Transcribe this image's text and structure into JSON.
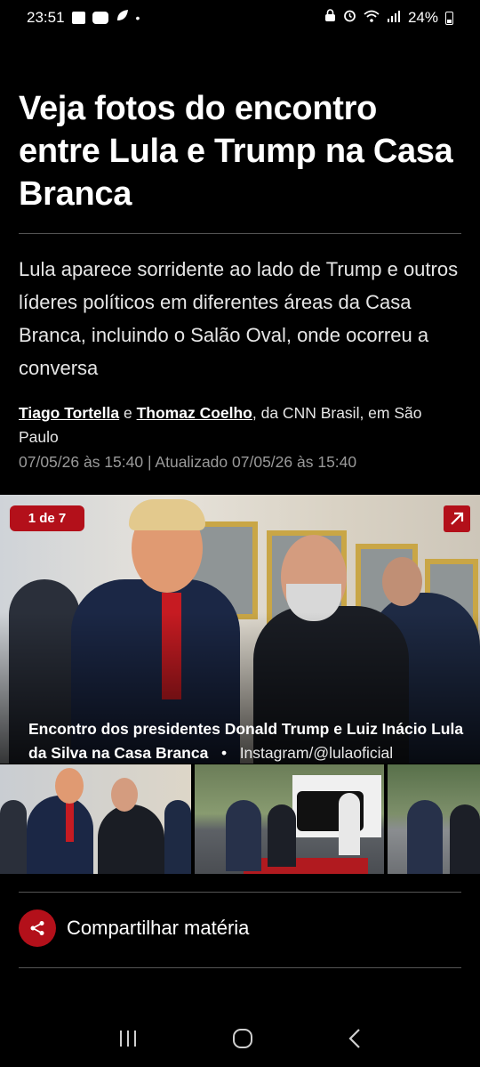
{
  "status_bar": {
    "time": "23:51",
    "left_icons": [
      "gallery-icon",
      "youtube-icon",
      "leaf-icon"
    ],
    "dot": "•",
    "right_icons": [
      "lock-icon",
      "alarm-icon",
      "wifi-icon",
      "signal-icon",
      "battery-icon"
    ],
    "battery_percent": "24%"
  },
  "article": {
    "headline": "Veja fotos do encontro entre Lula e Trump na Casa Branca",
    "subtitle": "Lula aparece sorridente ao lado de Trump e outros líderes políticos em diferentes áreas da Casa Branca, incluindo o Salão Oval, onde ocorreu a conversa",
    "byline": {
      "author1": "Tiago Tortella",
      "conjunction": " e ",
      "author2": "Thomaz Coelho",
      "suffix": ", da CNN Brasil, em São Paulo"
    },
    "dates": "07/05/26 às 15:40 | Atualizado 07/05/26 às 15:40"
  },
  "gallery": {
    "counter": "1 de 7",
    "caption": "Encontro dos presidentes Donald Trump e Luiz Inácio Lula da Silva na Casa Branca",
    "separator": "•",
    "credit": "Instagram/@lulaoficial",
    "thumbnail_count": 3
  },
  "share": {
    "label": "Compartilhar matéria"
  },
  "colors": {
    "accent": "#b3101a",
    "background": "#000000",
    "divider": "#555555",
    "muted_text": "#9a9a9a"
  },
  "navbar": {
    "icons": [
      "recent-apps-icon",
      "home-icon",
      "back-icon"
    ]
  }
}
